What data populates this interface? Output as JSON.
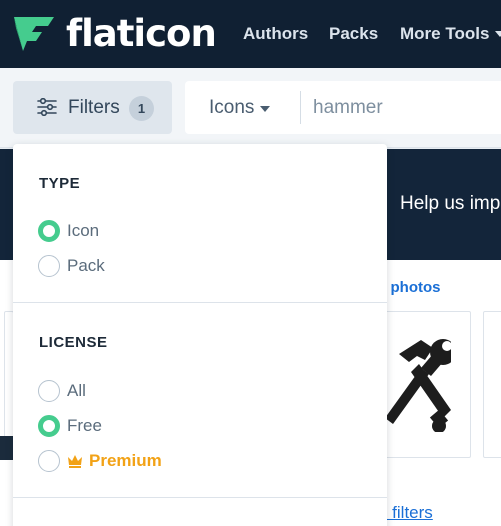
{
  "navbar": {
    "logo_text": "flaticon",
    "links": {
      "authors": "Authors",
      "packs": "Packs",
      "more_tools": "More Tools"
    },
    "background": "#102033",
    "brand_green": "#45cc8e"
  },
  "search": {
    "filters_label": "Filters",
    "filters_count": "1",
    "type_selected": "Icons",
    "query": "hammer"
  },
  "background_content": {
    "banner_text": "Help us imp",
    "photos_link": "e photos",
    "filters_link": "e filters"
  },
  "dropdown": {
    "type": {
      "title": "TYPE",
      "options": [
        {
          "label": "Icon",
          "checked": true
        },
        {
          "label": "Pack",
          "checked": false
        }
      ]
    },
    "license": {
      "title": "LICENSE",
      "options": [
        {
          "label": "All",
          "checked": false
        },
        {
          "label": "Free",
          "checked": true
        },
        {
          "label": "Premium",
          "checked": false,
          "icon": "crown-icon",
          "color": "#f2a216"
        }
      ]
    }
  }
}
